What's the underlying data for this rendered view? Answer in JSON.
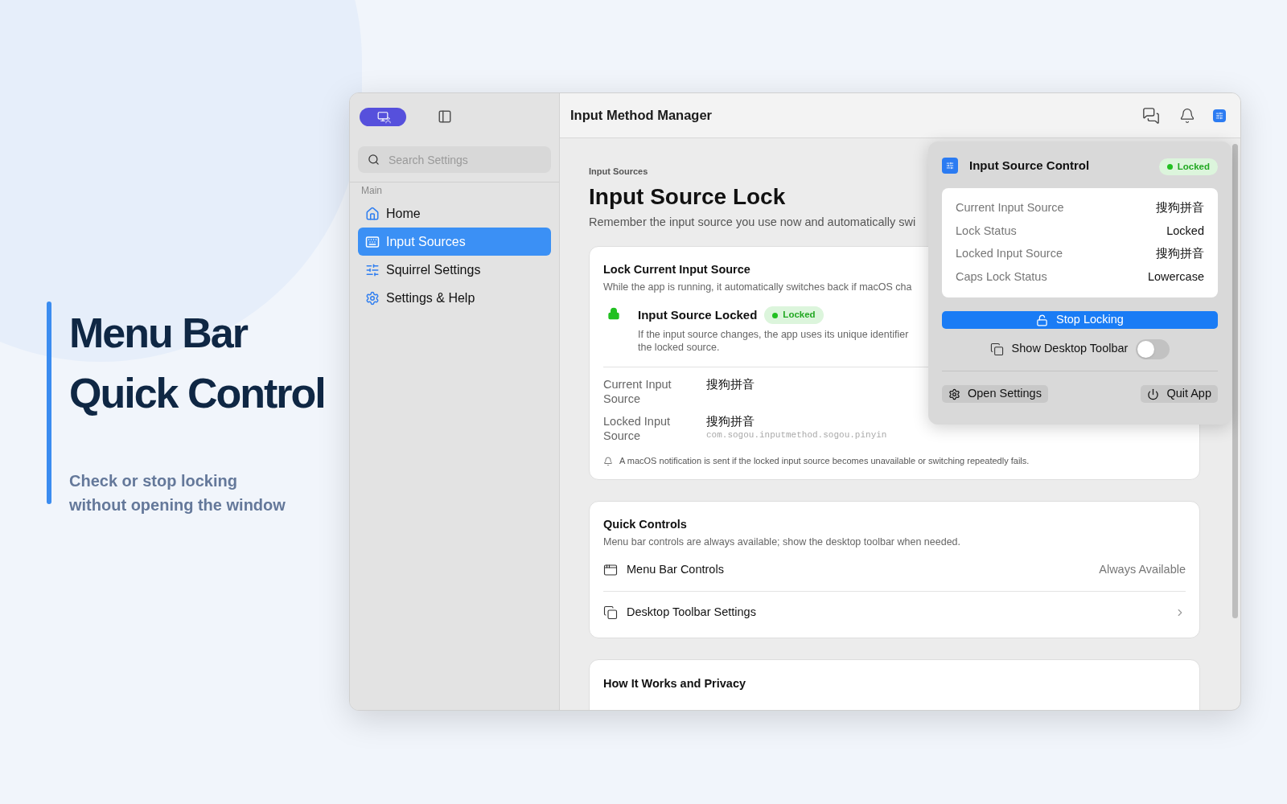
{
  "promo": {
    "title_lines": [
      "Menu Bar",
      "Quick Control"
    ],
    "subtitle_lines": [
      "Check or stop locking",
      "without opening the window"
    ]
  },
  "sidebar": {
    "search": {
      "placeholder": "Search Settings"
    },
    "section": "Main",
    "items": [
      {
        "label": "Home",
        "selected": false
      },
      {
        "label": "Input Sources",
        "selected": true
      },
      {
        "label": "Squirrel Settings",
        "selected": false
      },
      {
        "label": "Settings & Help",
        "selected": false
      }
    ]
  },
  "toolbar": {
    "title": "Input Method Manager"
  },
  "page": {
    "breadcrumb": "Input Sources",
    "title": "Input Source Lock",
    "description": "Remember the input source you use now and automatically swi"
  },
  "lock_card": {
    "title": "Lock Current Input Source",
    "description": "While the app is running, it automatically switches back if macOS cha",
    "status_title": "Input Source Locked",
    "locked": true,
    "badge": "Locked",
    "status_lines": [
      "If the input source changes, the app uses its unique identifier",
      "the locked source."
    ],
    "rows": [
      {
        "label": "Current Input Source",
        "value": "搜狗拼音"
      },
      {
        "label": "Locked Input Source",
        "value": "搜狗拼音",
        "detail": "com.sogou.inputmethod.sogou.pinyin"
      }
    ],
    "note": "A macOS notification is sent if the locked input source becomes unavailable or switching repeatedly fails."
  },
  "quick_controls": {
    "title": "Quick Controls",
    "description": "Menu bar controls are always available; show the desktop toolbar when needed.",
    "rows": [
      {
        "kind": "value",
        "label": "Menu Bar Controls",
        "value": "Always Available"
      },
      {
        "kind": "link",
        "label": "Desktop Toolbar Settings"
      }
    ]
  },
  "privacy_card": {
    "title": "How It Works and Privacy"
  },
  "popover": {
    "title": "Input Source Control",
    "locked": true,
    "badge": "Locked",
    "rows": [
      {
        "label": "Current Input Source",
        "value": "搜狗拼音"
      },
      {
        "label": "Lock Status",
        "value": "Locked"
      },
      {
        "label": "Locked Input Source",
        "value": "搜狗拼音"
      },
      {
        "label": "Caps Lock Status",
        "value": "Lowercase"
      }
    ],
    "stop_button": "Stop Locking",
    "toggle": {
      "label": "Show Desktop Toolbar",
      "on": false
    },
    "open_settings": "Open Settings",
    "quit": "Quit App"
  }
}
